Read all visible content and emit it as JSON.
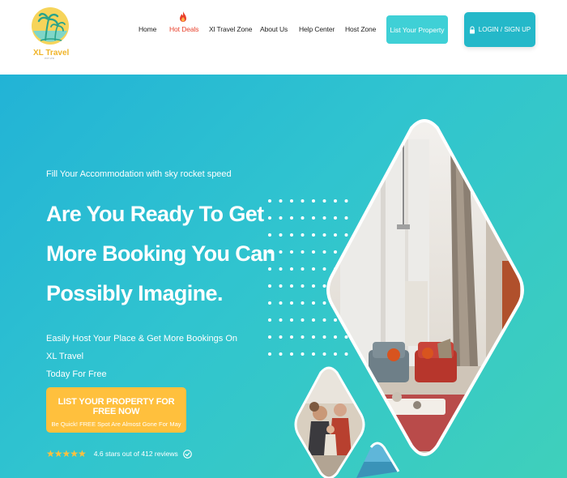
{
  "brand": {
    "logo_text": "XL Travel",
    "logo_tagline": "PVT LTD"
  },
  "nav": {
    "items": [
      {
        "label": "Home"
      },
      {
        "label": "Hot Deals"
      },
      {
        "label": "Xl Travel Zone"
      },
      {
        "label": "About Us"
      },
      {
        "label": "Help Center"
      },
      {
        "label": "Host Zone"
      }
    ],
    "list_property_label": "List Your Property",
    "login_label": "LOGIN / SIGN UP"
  },
  "hero": {
    "tagline": "Fill Your Accommodation with sky rocket speed",
    "headline": [
      "Are You Ready To Get",
      "More Booking You Can",
      "Possibly Imagine."
    ],
    "subtext": [
      "Easily Host Your Place & Get More Bookings On XL Travel",
      "Today For Free"
    ],
    "cta": {
      "title": "LIST YOUR PROPERTY FOR FREE NOW",
      "subtitle": "Be Quick! FREE Spot Are Almost Gone For May"
    },
    "rating": {
      "stars": "★★★★★",
      "text": "4.6 stars out of 412 reviews"
    }
  },
  "colors": {
    "accent": "#24b8c9",
    "hot": "#e8412c",
    "cta": "#ffc03d",
    "hero_gradient_start": "#22b3d6",
    "hero_gradient_end": "#3fd0bb"
  },
  "icons": [
    "flame-icon",
    "lock-icon",
    "verified-icon",
    "star-icon",
    "palm-tree-logo"
  ]
}
